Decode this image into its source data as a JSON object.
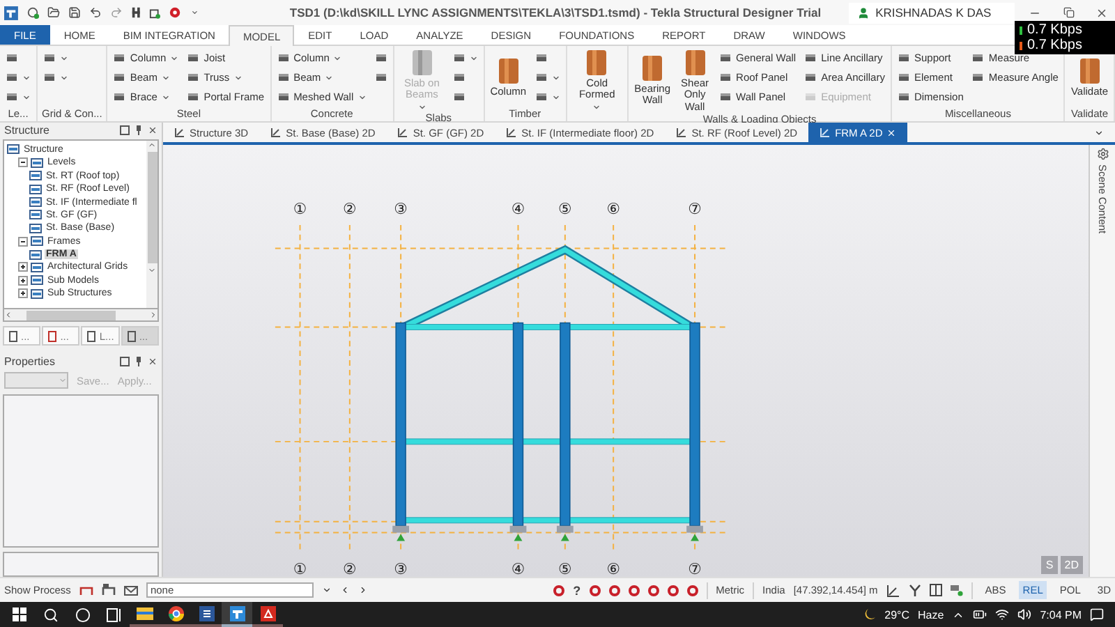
{
  "title_bar": {
    "title": "TSD1 (D:\\kd\\SKILL LYNC ASSIGNMENTS\\TEKLA\\3\\TSD1.tsmd) - Tekla Structural Designer Trial",
    "user": "KRISHNADAS K DAS"
  },
  "network_meter": {
    "upload": "0.7 Kbps",
    "download": "0.7 Kbps"
  },
  "menu_tabs": [
    {
      "label": "FILE",
      "kind": "file",
      "selected": false
    },
    {
      "label": "HOME",
      "kind": "tab",
      "selected": false
    },
    {
      "label": "BIM INTEGRATION",
      "kind": "tab",
      "selected": false
    },
    {
      "label": "MODEL",
      "kind": "tab",
      "selected": true
    },
    {
      "label": "EDIT",
      "kind": "tab",
      "selected": false
    },
    {
      "label": "LOAD",
      "kind": "tab",
      "selected": false
    },
    {
      "label": "ANALYZE",
      "kind": "tab",
      "selected": false
    },
    {
      "label": "DESIGN",
      "kind": "tab",
      "selected": false
    },
    {
      "label": "FOUNDATIONS",
      "kind": "tab",
      "selected": false
    },
    {
      "label": "REPORT",
      "kind": "tab",
      "selected": false
    },
    {
      "label": "DRAW",
      "kind": "tab",
      "selected": false
    },
    {
      "label": "WINDOWS",
      "kind": "tab",
      "selected": false
    }
  ],
  "ribbon_groups": [
    {
      "label": "Le...",
      "columns": [
        [
          {
            "kind": "icon",
            "dropdown": false,
            "disabled": false
          },
          {
            "kind": "icon",
            "dropdown": true,
            "disabled": false
          },
          {
            "kind": "icon",
            "dropdown": true,
            "disabled": false
          }
        ]
      ]
    },
    {
      "label": "Grid & Con...",
      "columns": [
        [
          {
            "kind": "icon",
            "dropdown": true,
            "disabled": false
          },
          {
            "kind": "icon",
            "dropdown": true,
            "disabled": false
          }
        ]
      ]
    },
    {
      "label": "Steel",
      "columns": [
        [
          {
            "kind": "small",
            "label": "Column",
            "dropdown": true,
            "disabled": false
          },
          {
            "kind": "small",
            "label": "Beam",
            "dropdown": true,
            "disabled": false
          },
          {
            "kind": "small",
            "label": "Brace",
            "dropdown": true,
            "disabled": false
          }
        ],
        [
          {
            "kind": "small",
            "label": "Joist",
            "dropdown": false,
            "disabled": false
          },
          {
            "kind": "small",
            "label": "Truss",
            "dropdown": true,
            "disabled": false
          },
          {
            "kind": "small",
            "label": "Portal Frame",
            "dropdown": false,
            "disabled": false
          }
        ]
      ]
    },
    {
      "label": "Concrete",
      "columns": [
        [
          {
            "kind": "small",
            "label": "Column",
            "dropdown": true,
            "disabled": false
          },
          {
            "kind": "small",
            "label": "Beam",
            "dropdown": true,
            "disabled": false
          },
          {
            "kind": "small",
            "label": "Meshed Wall",
            "dropdown": true,
            "disabled": false
          }
        ],
        [
          {
            "kind": "icon",
            "dropdown": false,
            "disabled": false
          },
          {
            "kind": "icon",
            "dropdown": false,
            "disabled": false
          }
        ]
      ]
    },
    {
      "label": "Slabs",
      "columns": [
        [
          {
            "kind": "large",
            "label": "Slab on Beams",
            "dropdown": true,
            "disabled": true
          }
        ],
        [
          {
            "kind": "icon",
            "dropdown": true,
            "disabled": false
          },
          {
            "kind": "icon",
            "dropdown": false,
            "disabled": false
          },
          {
            "kind": "icon",
            "dropdown": false,
            "disabled": false
          }
        ]
      ]
    },
    {
      "label": "Timber",
      "columns": [
        [
          {
            "kind": "large",
            "label": "Column",
            "dropdown": false,
            "disabled": false
          }
        ],
        [
          {
            "kind": "icon",
            "dropdown": false,
            "disabled": false
          },
          {
            "kind": "icon",
            "dropdown": true,
            "disabled": false
          },
          {
            "kind": "icon",
            "dropdown": true,
            "disabled": false
          }
        ]
      ]
    },
    {
      "columns": [
        [
          {
            "kind": "large",
            "label": "Cold Formed",
            "dropdown": true,
            "disabled": false
          }
        ]
      ]
    },
    {
      "label": "Walls & Loading Objects",
      "columns": [
        [
          {
            "kind": "large",
            "label": "Bearing Wall",
            "dropdown": false,
            "disabled": false
          }
        ],
        [
          {
            "kind": "large",
            "label": "Shear Only Wall",
            "dropdown": false,
            "disabled": false
          }
        ],
        [
          {
            "kind": "small",
            "label": "General Wall",
            "dropdown": false,
            "disabled": false
          },
          {
            "kind": "small",
            "label": "Roof Panel",
            "dropdown": false,
            "disabled": false
          },
          {
            "kind": "small",
            "label": "Wall Panel",
            "dropdown": false,
            "disabled": false
          }
        ],
        [
          {
            "kind": "small",
            "label": "Line Ancillary",
            "dropdown": false,
            "disabled": false
          },
          {
            "kind": "small",
            "label": "Area Ancillary",
            "dropdown": false,
            "disabled": false
          },
          {
            "kind": "small",
            "label": "Equipment",
            "dropdown": false,
            "disabled": true
          }
        ]
      ]
    },
    {
      "label": "Miscellaneous",
      "columns": [
        [
          {
            "kind": "small",
            "label": "Support",
            "dropdown": false,
            "disabled": false
          },
          {
            "kind": "small",
            "label": "Element",
            "dropdown": false,
            "disabled": false
          },
          {
            "kind": "small",
            "label": "Dimension",
            "dropdown": false,
            "disabled": false
          }
        ],
        [
          {
            "kind": "small",
            "label": "Measure",
            "dropdown": false,
            "disabled": false
          },
          {
            "kind": "small",
            "label": "Measure Angle",
            "dropdown": false,
            "disabled": false
          }
        ]
      ]
    },
    {
      "label": "Validate",
      "columns": [
        [
          {
            "kind": "large",
            "label": "Validate",
            "dropdown": false,
            "disabled": false
          }
        ]
      ]
    }
  ],
  "structure_panel": {
    "title": "Structure",
    "tree": [
      {
        "label": "Structure",
        "selected": false,
        "children": [
          {
            "label": "Levels",
            "selected": false,
            "expanded": true,
            "children": [
              {
                "label": "St. RT (Roof top)",
                "selected": false
              },
              {
                "label": "St. RF (Roof Level)",
                "selected": false
              },
              {
                "label": "St. IF (Intermediate fl",
                "selected": false
              },
              {
                "label": "St. GF (GF)",
                "selected": false
              },
              {
                "label": "St. Base (Base)",
                "selected": false
              }
            ]
          },
          {
            "label": "Frames",
            "selected": false,
            "expanded": true,
            "children": [
              {
                "label": "FRM A",
                "selected": true
              }
            ]
          },
          {
            "label": "Architectural Grids",
            "selected": false,
            "expanded": false
          },
          {
            "label": "Sub Models",
            "selected": false,
            "expanded": false
          },
          {
            "label": "Sub Structures",
            "selected": false,
            "expanded": false
          }
        ]
      }
    ],
    "tabs": [
      {
        "label": "...",
        "selected": false
      },
      {
        "label": "...",
        "selected": false
      },
      {
        "label": "L...",
        "selected": false
      },
      {
        "label": "...",
        "selected": true
      }
    ]
  },
  "properties_panel": {
    "title": "Properties",
    "buttons": [
      {
        "label": "Save...",
        "disabled": true
      },
      {
        "label": "Apply...",
        "disabled": true
      }
    ]
  },
  "doc_tabs": [
    {
      "label": "Structure 3D",
      "selected": false
    },
    {
      "label": "St. Base (Base) 2D",
      "selected": false
    },
    {
      "label": "St. GF (GF) 2D",
      "selected": false
    },
    {
      "label": "St. IF (Intermediate floor) 2D",
      "selected": false
    },
    {
      "label": "St. RF (Roof Level) 2D",
      "selected": false
    },
    {
      "label": "FRM A 2D",
      "selected": true
    }
  ],
  "side_strip": {
    "label": "Scene Content"
  },
  "grid": {
    "top_labels": [
      "①",
      "②",
      "③",
      "④",
      "⑤",
      "⑥",
      "⑦"
    ],
    "bottom_labels": [
      "①",
      "②",
      "③",
      "④",
      "⑤",
      "⑥",
      "⑦"
    ]
  },
  "view_buttons": [
    "S",
    "2D"
  ],
  "status_bar": {
    "show_process": "Show Process",
    "process_field": {
      "value": "none"
    },
    "help": "?",
    "units": "Metric",
    "region": "India",
    "coordinates": "[47.392,14.454] m",
    "modes": [
      {
        "label": "ABS",
        "selected": false
      },
      {
        "label": "REL",
        "selected": true
      },
      {
        "label": "POL",
        "selected": false
      },
      {
        "label": "3D",
        "selected": false
      }
    ]
  },
  "taskbar": {
    "apps": [
      {
        "kind": "explorer",
        "selected": false
      },
      {
        "kind": "chrome",
        "selected": false
      },
      {
        "kind": "word",
        "selected": false
      },
      {
        "kind": "tekla",
        "selected": true
      },
      {
        "kind": "acrobat",
        "selected": false
      }
    ],
    "weather": {
      "temperature": "29°C",
      "condition": "Haze"
    },
    "clock": "7:04 PM"
  }
}
